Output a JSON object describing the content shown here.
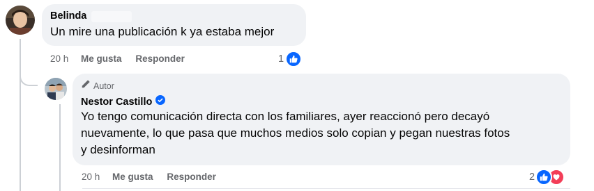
{
  "comment": {
    "author": "Belinda",
    "text": "Un mire una publicación k ya estaba mejor",
    "time": "20 h",
    "like_label": "Me gusta",
    "reply_label": "Responder",
    "reaction_count": "1",
    "reactions": [
      "like-icon"
    ]
  },
  "reply": {
    "author_badge": "Autor",
    "author": "Nestor Castillo",
    "verified_icon": "verified-badge-icon",
    "text_lines": [
      "Yo tengo comunicación directa con los familiares, ayer reaccionó pero decayó",
      "nuevamente, lo que pasa que muchos medios solo copian y pegan nuestras fotos",
      "y desinforman"
    ],
    "time": "20 h",
    "like_label": "Me gusta",
    "reply_label": "Responder",
    "reaction_count": "2",
    "reactions": [
      "like-icon",
      "heart-icon"
    ]
  },
  "colors": {
    "bubble": "#f0f2f5",
    "meta_text": "#65676b",
    "like_blue": "#0866ff",
    "love_red": "#f33e58",
    "verified_blue": "#0866ff"
  }
}
